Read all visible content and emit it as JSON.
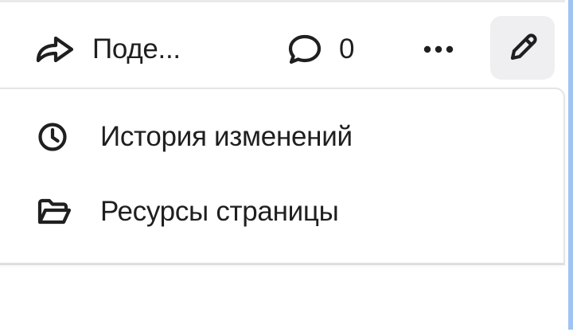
{
  "toolbar": {
    "share_label": "Поде...",
    "comments_count": "0",
    "share_icon": "share-arrow-icon",
    "comments_icon": "speech-bubble-icon",
    "more_icon": "more-horizontal-icon",
    "edit_icon": "pencil-icon"
  },
  "menu": {
    "items": [
      {
        "label": "История изменений",
        "icon": "clock-icon"
      },
      {
        "label": "Ресурсы страницы",
        "icon": "folder-icon"
      }
    ]
  },
  "colors": {
    "text": "#1f1f1f",
    "edit_button_bg": "#efeff2",
    "border": "#e4e4e7",
    "right_accent": "#9fc3f2"
  }
}
